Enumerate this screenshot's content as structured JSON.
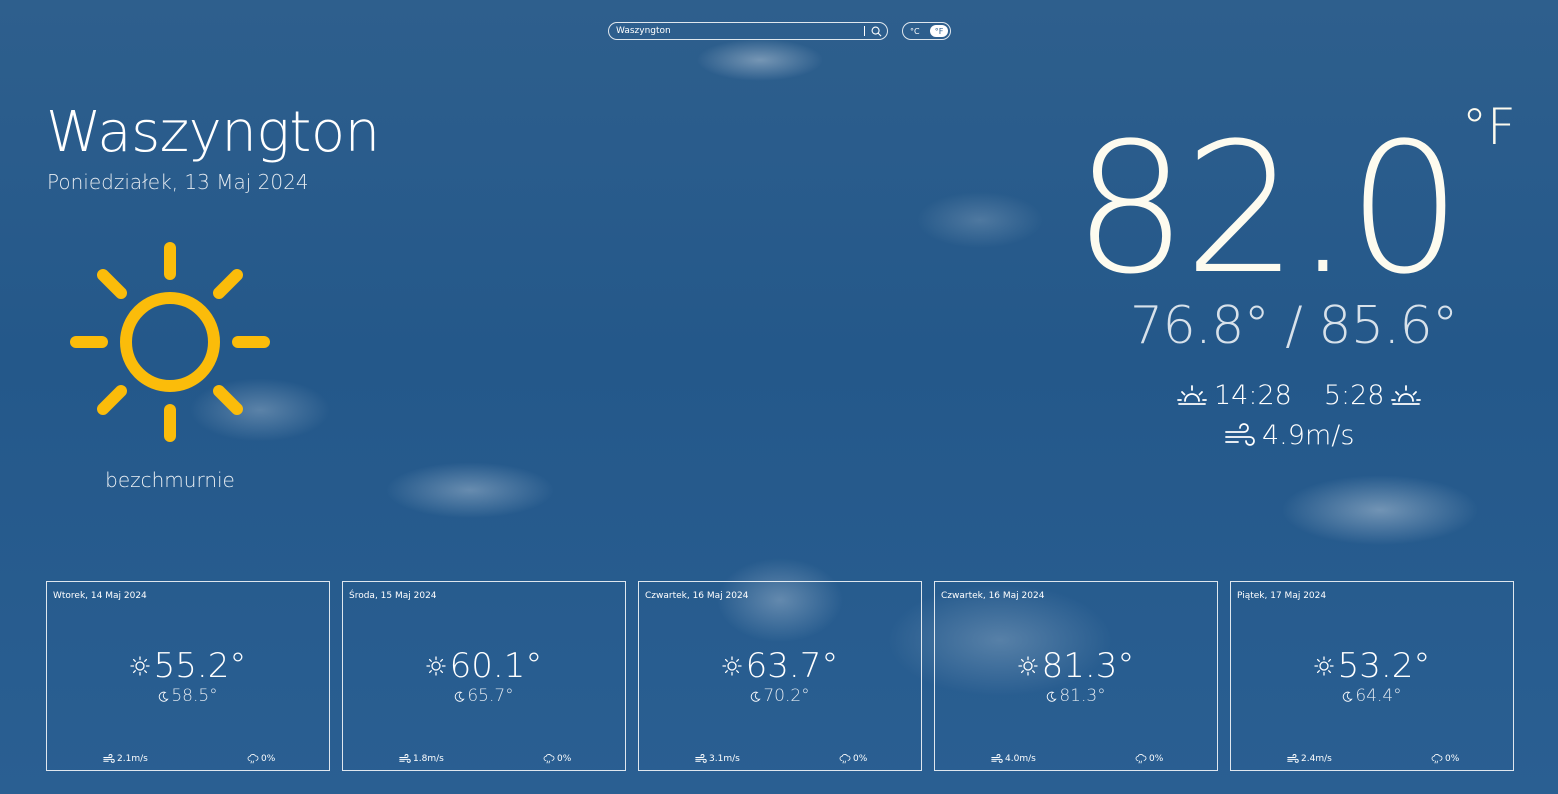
{
  "search": {
    "value": "Waszyngton"
  },
  "units": {
    "celsius": "°C",
    "fahrenheit": "°F",
    "selected": "fahrenheit"
  },
  "current": {
    "city": "Waszyngton",
    "date": "Poniedziałek, 13 Maj 2024",
    "condition": "bezchmurnie",
    "icon": "sun-icon",
    "temperature": "82.0",
    "unit": "°F",
    "minmax": "76.8° / 85.6°",
    "sunrise": "14:28",
    "sunset": "5:28",
    "wind": "4.9m/s"
  },
  "colors": {
    "sun": "#fbbc0a",
    "background": "#24588a"
  },
  "forecast": [
    {
      "date": "Wtorek, 14 Maj 2024",
      "day_temp": "55.2°",
      "night_temp": "58.5°",
      "wind": "2.1m/s",
      "rain": "0%"
    },
    {
      "date": "Środa, 15 Maj 2024",
      "day_temp": "60.1°",
      "night_temp": "65.7°",
      "wind": "1.8m/s",
      "rain": "0%"
    },
    {
      "date": "Czwartek, 16 Maj 2024",
      "day_temp": "63.7°",
      "night_temp": "70.2°",
      "wind": "3.1m/s",
      "rain": "0%"
    },
    {
      "date": "Czwartek, 16 Maj 2024",
      "day_temp": "81.3°",
      "night_temp": "81.3°",
      "wind": "4.0m/s",
      "rain": "0%"
    },
    {
      "date": "Piątek, 17 Maj 2024",
      "day_temp": "53.2°",
      "night_temp": "64.4°",
      "wind": "2.4m/s",
      "rain": "0%"
    }
  ]
}
